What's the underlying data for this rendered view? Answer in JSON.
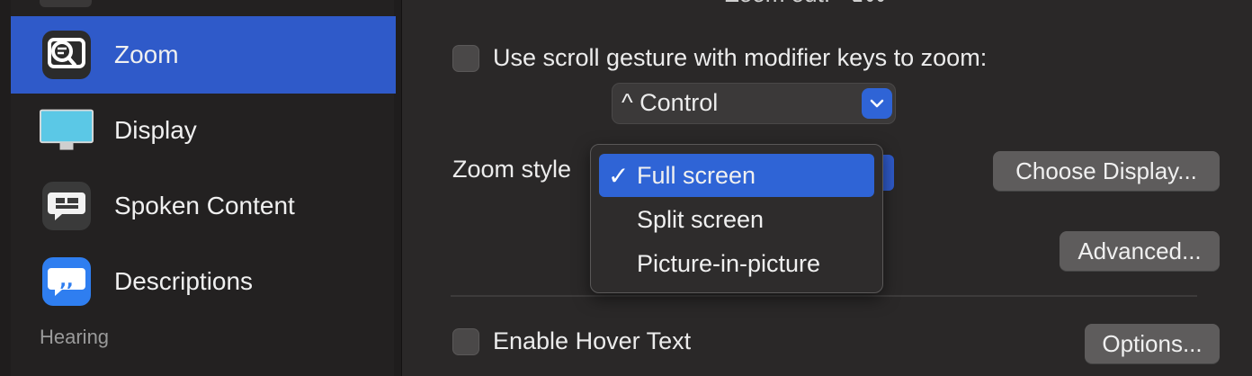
{
  "sidebar": {
    "items": [
      {
        "label": "Zoom",
        "icon": "zoom-icon",
        "selected": true
      },
      {
        "label": "Display",
        "icon": "display-icon",
        "selected": false
      },
      {
        "label": "Spoken Content",
        "icon": "spoken-content-icon",
        "selected": false
      },
      {
        "label": "Descriptions",
        "icon": "descriptions-icon",
        "selected": false
      }
    ],
    "section_header": "Hearing"
  },
  "main": {
    "top_cut_text": "Zoom out:  ⌥⌘-",
    "scroll_gesture": {
      "label": "Use scroll gesture with modifier keys to zoom:",
      "checked": false
    },
    "modifier_popup": {
      "value": "^ Control"
    },
    "zoom_style": {
      "label": "Zoom style"
    },
    "choose_display_button": "Choose Display...",
    "advanced_button": "Advanced...",
    "hover_text": {
      "label": "Enable Hover Text",
      "checked": false
    },
    "options_button": "Options..."
  },
  "zoom_style_menu": {
    "items": [
      {
        "label": "Full screen",
        "selected": true
      },
      {
        "label": "Split screen",
        "selected": false
      },
      {
        "label": "Picture-in-picture",
        "selected": false
      }
    ]
  },
  "colors": {
    "accent": "#2f5ac9",
    "background": "#2a2828",
    "sidebar": "#232121"
  }
}
